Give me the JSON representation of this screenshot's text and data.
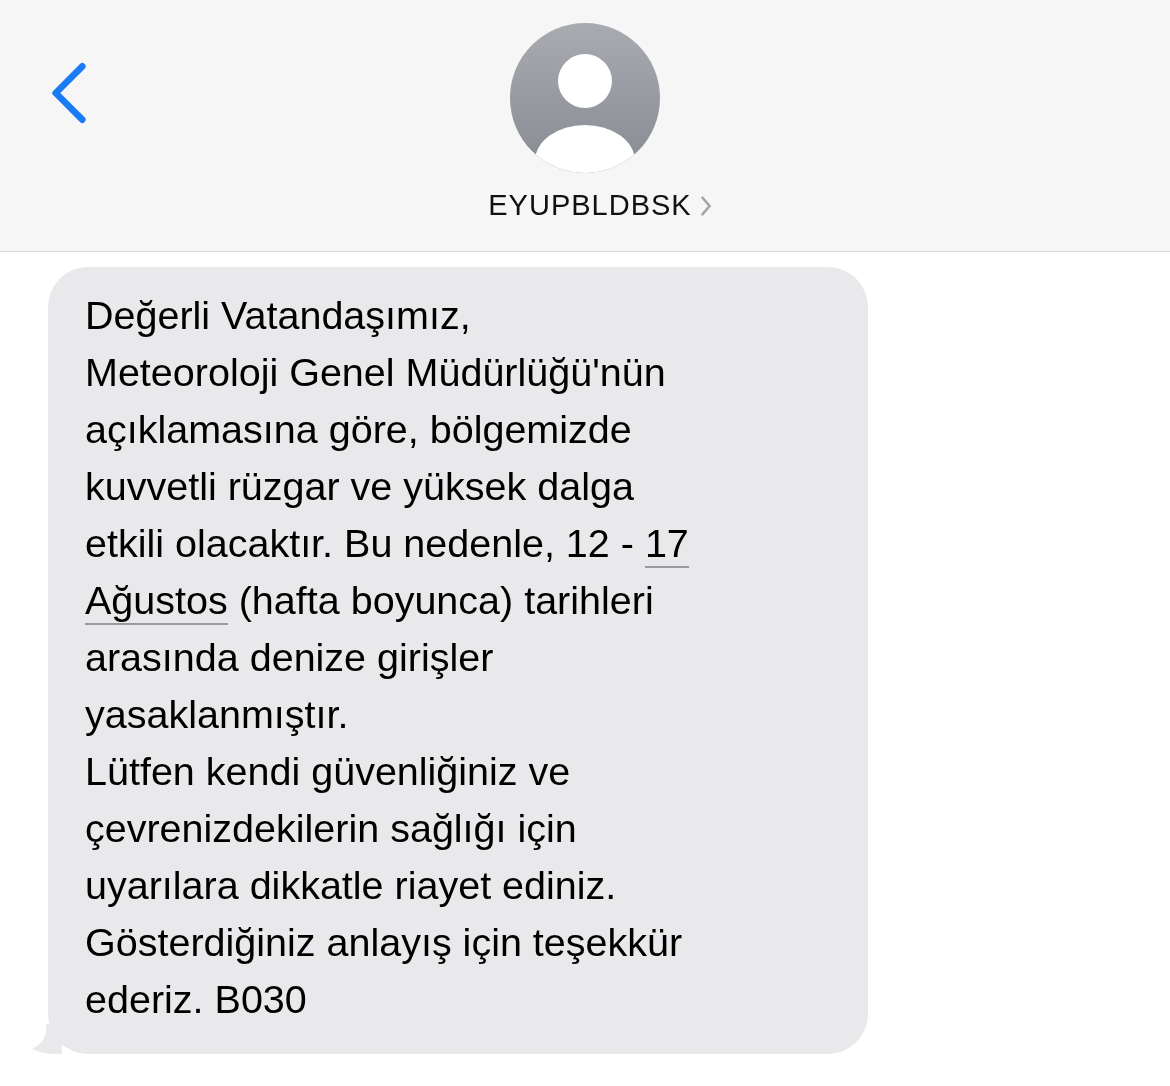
{
  "header": {
    "contact": {
      "name": "EYUPBLDBSK"
    }
  },
  "message": {
    "lines": [
      [
        {
          "text": "Değerli Vatandaşımız,",
          "link": false
        }
      ],
      [
        {
          "text": "Meteoroloji Genel Müdürlüğü'nün",
          "link": false
        }
      ],
      [
        {
          "text": "açıklamasına göre, bölgemizde",
          "link": false
        }
      ],
      [
        {
          "text": "kuvvetli rüzgar ve yüksek dalga",
          "link": false
        }
      ],
      [
        {
          "text": "etkili olacaktır. Bu nedenle, 12 - ",
          "link": false
        },
        {
          "text": "17",
          "link": true
        }
      ],
      [
        {
          "text": "Ağustos",
          "link": true
        },
        {
          "text": " (hafta boyunca) tarihleri",
          "link": false
        }
      ],
      [
        {
          "text": "arasında denize girişler",
          "link": false
        }
      ],
      [
        {
          "text": "yasaklanmıştır.",
          "link": false
        }
      ],
      [
        {
          "text": "Lütfen kendi güvenliğiniz ve",
          "link": false
        }
      ],
      [
        {
          "text": "çevrenizdekilerin sağlığı için",
          "link": false
        }
      ],
      [
        {
          "text": "uyarılara dikkatle riayet ediniz.",
          "link": false
        }
      ],
      [
        {
          "text": "Gösterdiğiniz anlayış için teşekkür",
          "link": false
        }
      ],
      [
        {
          "text": "ederiz. B030",
          "link": false
        }
      ]
    ]
  }
}
